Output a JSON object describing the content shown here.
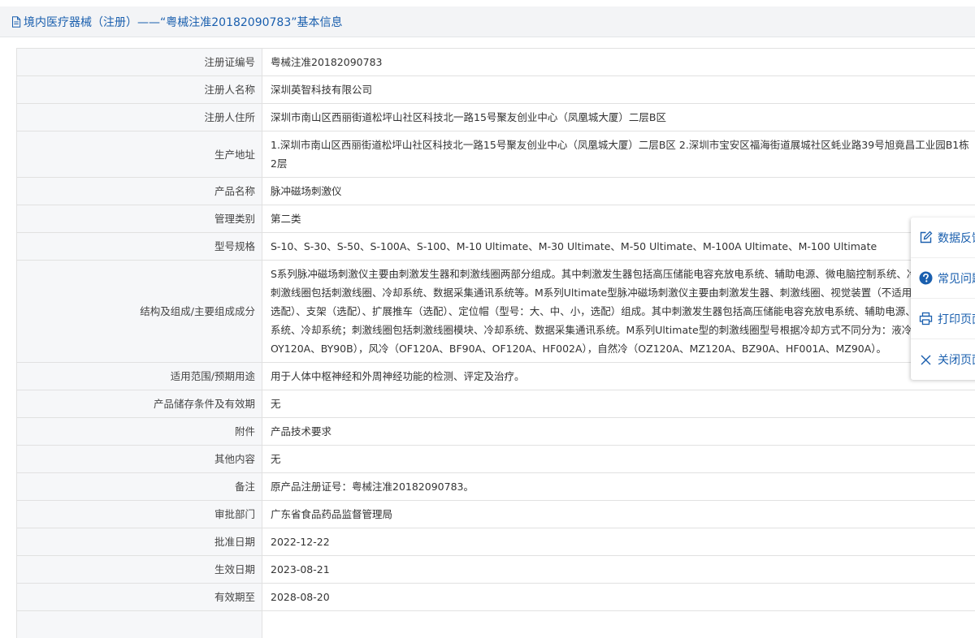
{
  "header": {
    "title": "境内医疗器械（注册）——“粤械注准20182090783”基本信息"
  },
  "rows": [
    {
      "label": "注册证编号",
      "value": "粤械注准20182090783"
    },
    {
      "label": "注册人名称",
      "value": "深圳英智科技有限公司"
    },
    {
      "label": "注册人住所",
      "value": "深圳市南山区西丽街道松坪山社区科技北一路15号聚友创业中心（凤凰城大厦）二层B区"
    },
    {
      "label": "生产地址",
      "value": "1.深圳市南山区西丽街道松坪山社区科技北一路15号聚友创业中心（凤凰城大厦）二层B区 2.深圳市宝安区福海街道展城社区蚝业路39号旭竟昌工业园B1栋2层"
    },
    {
      "label": "产品名称",
      "value": "脉冲磁场刺激仪"
    },
    {
      "label": "管理类别",
      "value": "第二类"
    },
    {
      "label": "型号规格",
      "value": "S-10、S-30、S-50、S-100A、S-100、M-10 Ultimate、M-30 Ultimate、M-50 Ultimate、M-100A Ultimate、M-100 Ultimate"
    },
    {
      "label": "结构及组成/主要组成成分",
      "value": "S系列脉冲磁场刺激仪主要由刺激发生器和刺激线圈两部分组成。其中刺激发生器包括高压储能电容充放电系统、辅助电源、微电脑控制系统、冷却系统等；刺激线圈包括刺激线圈、冷却系统、数据采集通讯系统等。M系列Ultimate型脉冲磁场刺激仪主要由刺激发生器、刺激线圈、视觉装置（不适用于H线圈，选配）、支架（选配）、扩展推车（选配）、定位帽（型号：大、中、小，选配）组成。其中刺激发生器包括高压储能电容充放电系统、辅助电源、微电脑控制系统、冷却系统；刺激线圈包括刺激线圈模块、冷却系统、数据采集通讯系统。M系列Ultimate型的刺激线圈型号根据冷却方式不同分为：液冷（BY90A、OY120A、BY90B），风冷（OF120A、BF90A、OF120A、HF002A），自然冷（OZ120A、MZ120A、BZ90A、HF001A、MZ90A）。"
    },
    {
      "label": "适用范围/预期用途",
      "value": "用于人体中枢神经和外周神经功能的检测、评定及治疗。"
    },
    {
      "label": "产品储存条件及有效期",
      "value": "无"
    },
    {
      "label": "附件",
      "value": "产品技术要求"
    },
    {
      "label": "其他内容",
      "value": "无"
    },
    {
      "label": "备注",
      "value": "原产品注册证号：粤械注准20182090783。"
    },
    {
      "label": "审批部门",
      "value": "广东省食品药品监督管理局"
    },
    {
      "label": "批准日期",
      "value": "2022-12-22"
    },
    {
      "label": "生效日期",
      "value": "2023-08-21"
    },
    {
      "label": "有效期至",
      "value": "2028-08-20"
    },
    {
      "label": "",
      "value": ""
    }
  ],
  "float_panel": {
    "items": [
      {
        "label": "数据反馈",
        "icon": "edit-icon"
      },
      {
        "label": "常见问题",
        "icon": "help-icon"
      },
      {
        "label": "打印页面",
        "icon": "print-icon"
      },
      {
        "label": "关闭页面",
        "icon": "close-icon"
      }
    ]
  },
  "colors": {
    "title": "#1a5fae",
    "label_bg": "#f6f7f9",
    "border": "#e1e1e1"
  }
}
